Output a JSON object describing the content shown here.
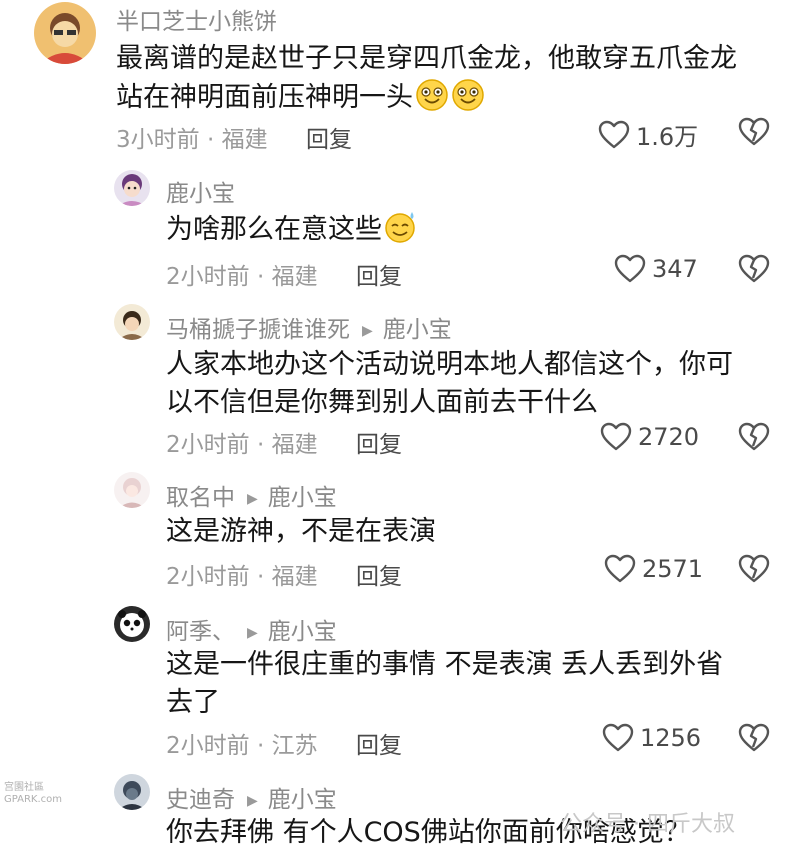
{
  "comments": [
    {
      "author": "半口芝士小熊饼",
      "line1": "最离谱的是赵世子只是穿四爪金龙，他敢穿五爪金龙",
      "line2": "站在神明面前压神明一头",
      "emoji": [
        "grinning-face-icon",
        "grinning-face-icon"
      ],
      "time": "3小时前 · 福建",
      "reply_label": "回复",
      "likes": "1.6万"
    },
    {
      "author": "鹿小宝",
      "line1": "为啥那么在意这些",
      "emoji": [
        "sweat-smile-face-icon"
      ],
      "time": "2小时前 · 福建",
      "reply_label": "回复",
      "likes": "347"
    },
    {
      "author": "马桶搋子搋谁谁死",
      "reply_to": "鹿小宝",
      "line1": "人家本地办这个活动说明本地人都信这个，你可",
      "line2": "以不信但是你舞到别人面前去干什么",
      "time": "2小时前 · 福建",
      "reply_label": "回复",
      "likes": "2720"
    },
    {
      "author": "取名中",
      "reply_to": "鹿小宝",
      "line1": "这是游神，不是在表演",
      "time": "2小时前 · 福建",
      "reply_label": "回复",
      "likes": "2571"
    },
    {
      "author": "阿季、",
      "reply_to": "鹿小宝",
      "line1": "这是一件很庄重的事情 不是表演 丢人丢到外省",
      "line2": "去了",
      "time": "2小时前 · 江苏",
      "reply_label": "回复",
      "likes": "1256"
    },
    {
      "author": "史迪奇",
      "reply_to": "鹿小宝",
      "line1": "你去拜佛 有个人COS佛站你面前你啥感觉？"
    }
  ],
  "watermark_left_top": "宫園社區",
  "watermark_left_bottom": "GPARK.com",
  "watermark_right": "公众号 · 四斤大叔",
  "colors": {
    "meta": "#9a9a9a",
    "text": "#161616",
    "icon": "#555555"
  }
}
